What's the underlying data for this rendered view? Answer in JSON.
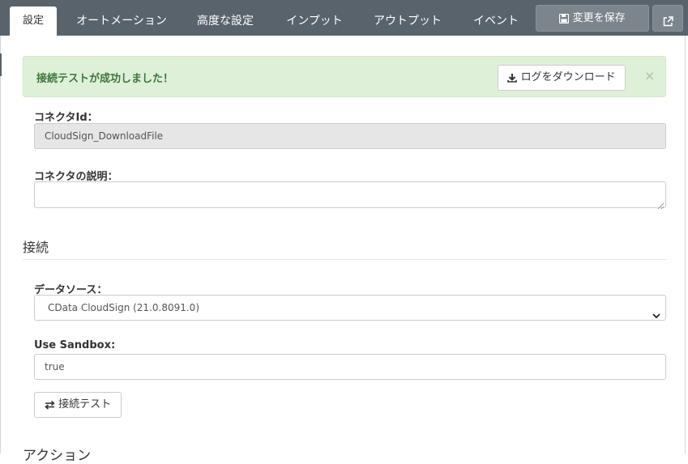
{
  "tabs": [
    {
      "label": "設定"
    },
    {
      "label": "オートメーション"
    },
    {
      "label": "高度な設定"
    },
    {
      "label": "インプット"
    },
    {
      "label": "アウトプット"
    },
    {
      "label": "イベント"
    }
  ],
  "toolbar": {
    "save_label": "変更を保存",
    "save_icon": "floppy-disk-icon",
    "external_icon": "external-link-icon"
  },
  "alert": {
    "message": "接続テストが成功しました！",
    "download_label": "ログをダウンロード",
    "download_icon": "download-icon",
    "close_label": "×"
  },
  "form": {
    "connector_id_label": "コネクタId：",
    "connector_id_value": "CloudSign_DownloadFile",
    "description_label": "コネクタの説明：",
    "description_value": ""
  },
  "connection": {
    "section_title": "接続",
    "datasource_label": "データソース：",
    "datasource_value": "CData CloudSign (21.0.8091.0)",
    "sandbox_label": "Use Sandbox:",
    "sandbox_value": "true",
    "test_button_label": "接続テスト",
    "test_button_icon": "exchange-arrows-icon"
  },
  "next_section_title": "アクション",
  "colors": {
    "topbar": "#59636b",
    "alert_bg": "#dff0d8",
    "alert_text": "#3c763d"
  }
}
